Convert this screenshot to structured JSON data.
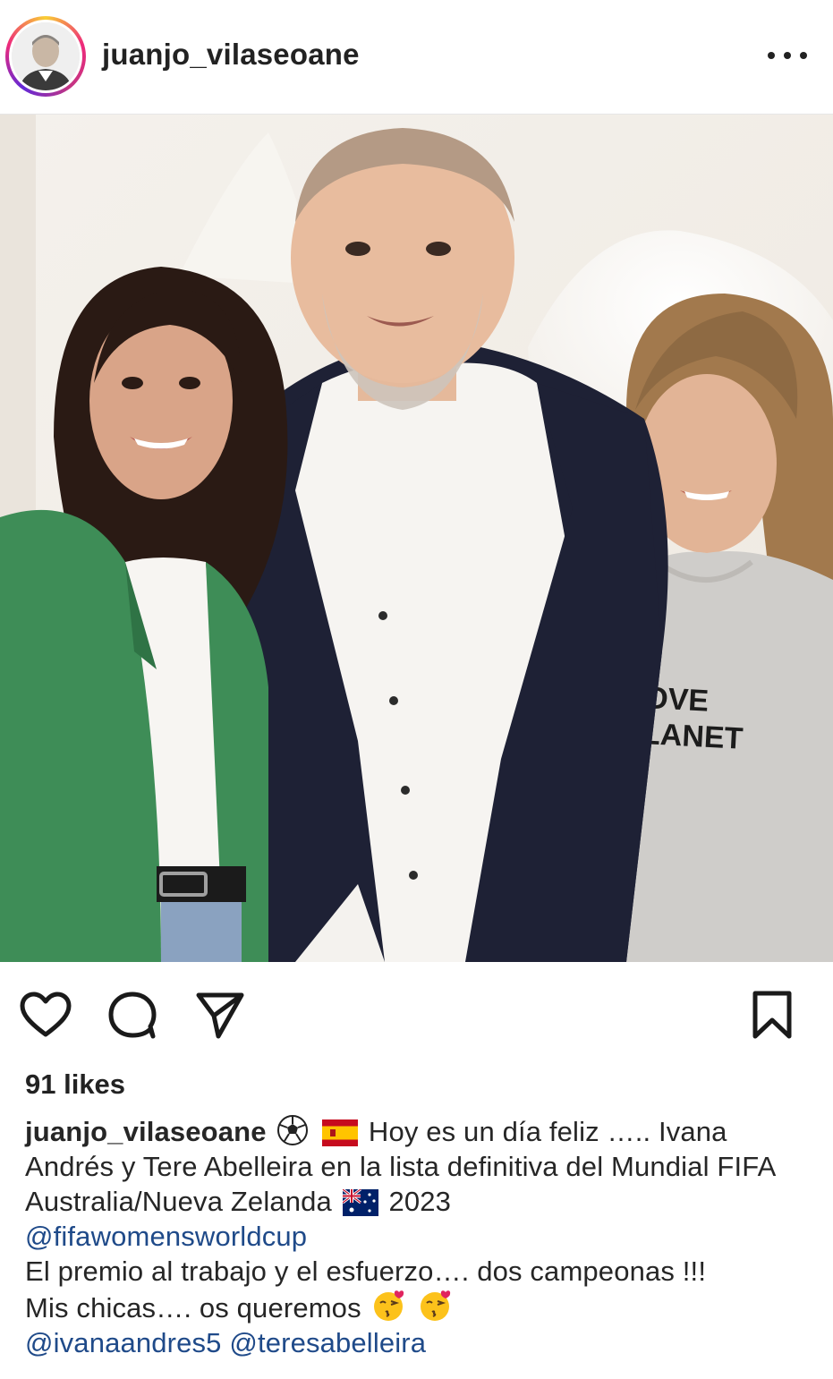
{
  "post": {
    "username": "juanjo_vilaseoane",
    "likes": "91 likes",
    "photo_tshirt_line1": "VE OVE",
    "photo_tshirt_line2": "R PLANET"
  },
  "caption": {
    "username": "juanjo_vilaseoane",
    "text1": "Hoy es un día feliz ….. Ivana Andrés y Tere Abelleira en la lista definitiva del Mundial FIFA Australia/Nueva Zelanda",
    "year": "2023",
    "mention1": "@fifawomensworldcup",
    "line2": "El premio al trabajo y el esfuerzo…. dos campeonas !!!",
    "line3": "Mis chicas…. os queremos",
    "mention2": "@ivanaandres5",
    "mention3": "@teresabelleira"
  },
  "icons": [
    "more-icon",
    "heart-icon",
    "comment-icon",
    "share-icon",
    "bookmark-icon",
    "soccer-ball-emoji",
    "spain-flag-emoji",
    "australia-flag-emoji",
    "kiss-emoji"
  ],
  "colors": {
    "mention": "#1f4a89",
    "ring_start": "#f9ce34",
    "ring_mid": "#ee2a7b",
    "ring_end": "#6228d7"
  }
}
